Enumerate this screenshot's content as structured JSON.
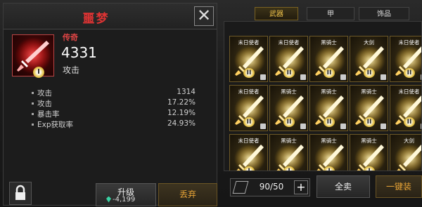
{
  "detail": {
    "title": "噩梦",
    "rarity": "传奇",
    "power": "4331",
    "power_label": "攻击",
    "tier": "I",
    "stats": [
      {
        "name": "攻击",
        "value": "1314"
      },
      {
        "name": "攻击",
        "value": "17.22%"
      },
      {
        "name": "暴击率",
        "value": "12.19%"
      },
      {
        "name": "Exp获取率",
        "value": "24.93%"
      }
    ],
    "upgrade_label": "升级",
    "upgrade_cost": "-4,199",
    "discard_label": "丢弃"
  },
  "tabs": [
    {
      "label": "武器",
      "active": true
    },
    {
      "label": "甲",
      "active": false
    },
    {
      "label": "饰品",
      "active": false
    }
  ],
  "inventory": {
    "slots": [
      {
        "name": "末日使者",
        "tier": "II"
      },
      {
        "name": "末日使者",
        "tier": "II"
      },
      {
        "name": "黑骑士",
        "tier": "II"
      },
      {
        "name": "大剑",
        "tier": "II"
      },
      {
        "name": "末日使者",
        "tier": "II"
      },
      {
        "name": "末日使者",
        "tier": "II"
      },
      {
        "name": "黑骑士",
        "tier": "II"
      },
      {
        "name": "黑骑士",
        "tier": "II"
      },
      {
        "name": "黑骑士",
        "tier": "II"
      },
      {
        "name": "末日使者",
        "tier": "II"
      },
      {
        "name": "末日使者",
        "tier": "I"
      },
      {
        "name": "黑骑士",
        "tier": "I"
      },
      {
        "name": "黑骑士",
        "tier": "I"
      },
      {
        "name": "黑骑士",
        "tier": "I"
      },
      {
        "name": "大剑",
        "tier": ""
      }
    ],
    "count": "90/50",
    "sell_all_label": "全卖",
    "equip_label": "一键装"
  },
  "colors": {
    "accent_gold": "#e8a436",
    "title_red": "#d33",
    "gem": "#3ad2a4"
  }
}
